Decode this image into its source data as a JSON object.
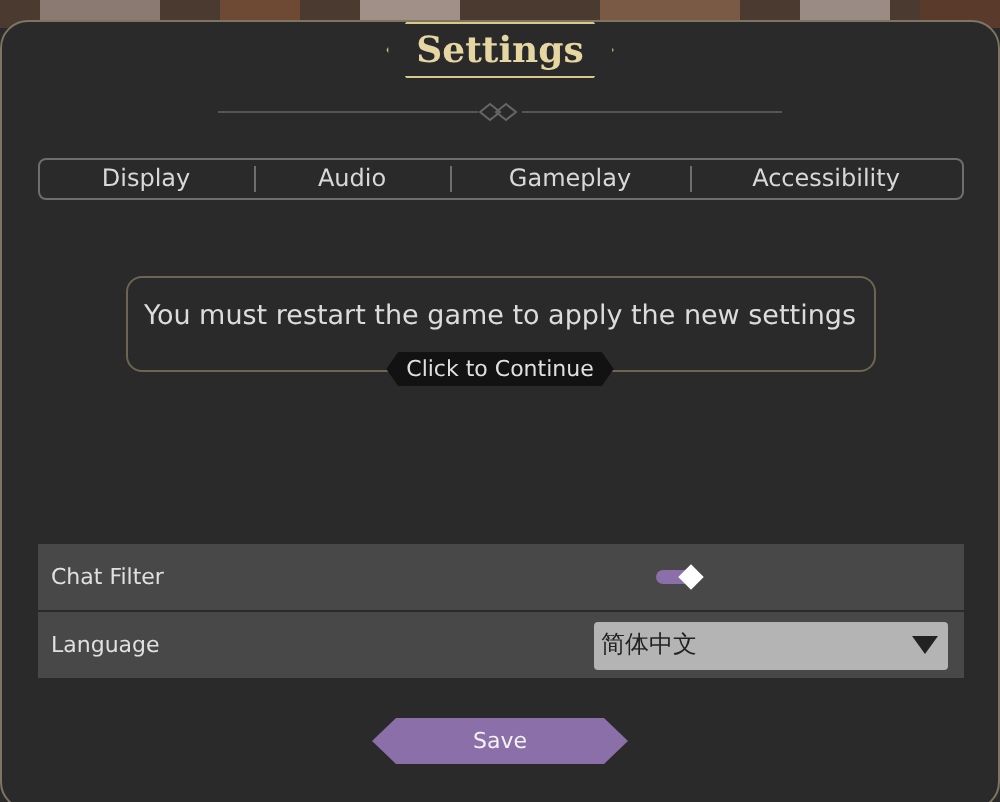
{
  "title": "Settings",
  "tabs": [
    {
      "label": "Display",
      "selected": false
    },
    {
      "label": "Audio",
      "selected": false
    },
    {
      "label": "Gameplay",
      "selected": false
    },
    {
      "label": "Accessibility",
      "selected": false
    }
  ],
  "notice": {
    "message": "You must restart the game to apply the new settings",
    "action": "Click to Continue"
  },
  "settings": [
    {
      "kind": "toggle",
      "label": "Chat Filter",
      "on": true
    },
    {
      "kind": "dropdown",
      "label": "Language",
      "value": "简体中文"
    }
  ],
  "save": "Save"
}
